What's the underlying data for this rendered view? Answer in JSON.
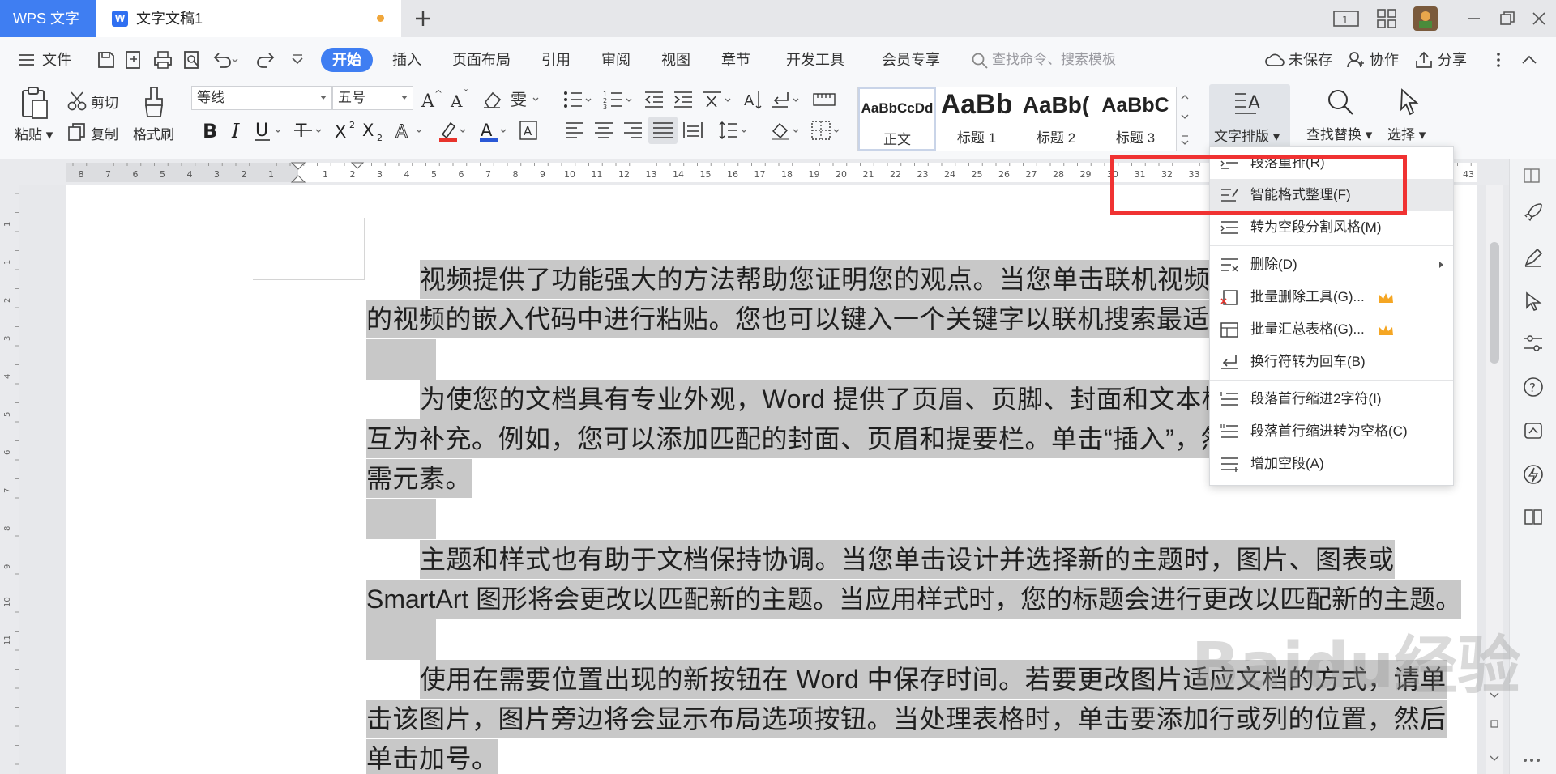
{
  "app": {
    "name": "WPS 文字",
    "document_title": "文字文稿1"
  },
  "menu": {
    "file": "文件",
    "tabs": [
      "开始",
      "插入",
      "页面布局",
      "引用",
      "审阅",
      "视图",
      "章节",
      "开发工具",
      "会员专享"
    ],
    "search_placeholder": "查找命令、搜索模板",
    "unsaved": "未保存",
    "collaborate": "协作",
    "share": "分享"
  },
  "ribbon": {
    "paste": "粘贴",
    "cut": "剪切",
    "copy": "复制",
    "format_painter": "格式刷",
    "font_name": "等线",
    "font_size": "五号",
    "styles": [
      {
        "preview": "AaBbCcDd",
        "name": "正文"
      },
      {
        "preview": "AaBb",
        "name": "标题 1"
      },
      {
        "preview": "AaBb(",
        "name": "标题 2"
      },
      {
        "preview": "AaBbC",
        "name": "标题 3"
      }
    ],
    "text_layout": "文字排版",
    "find_replace": "查找替换",
    "select": "选择"
  },
  "ruler": {
    "left_numbers": [
      "8",
      "7",
      "6",
      "5",
      "4",
      "3",
      "2",
      "1"
    ],
    "right_numbers": [
      "1",
      "2",
      "3",
      "4",
      "5",
      "6",
      "7",
      "8",
      "9",
      "10",
      "11",
      "12",
      "13",
      "14",
      "15",
      "16",
      "17",
      "18",
      "19",
      "20",
      "21",
      "22",
      "23",
      "24",
      "25",
      "26",
      "27",
      "28",
      "29",
      "30",
      "31",
      "32",
      "33"
    ],
    "end_number": "43",
    "v_numbers": [
      "1",
      "1",
      "2",
      "3",
      "4",
      "5",
      "6",
      "7",
      "8",
      "9",
      "10",
      "11"
    ]
  },
  "document": {
    "paragraphs": [
      [
        "视频提供了功能强大的方法帮助您证明您的观点。当您单击联机视频时，",
        "的视频的嵌入代码中进行粘贴。您也可以键入一个关键字以联机搜索最适合您"
      ],
      [
        "为使您的文档具有专业外观，Word 提供了页眉、页脚、封面和文本框设",
        "互为补充。例如，您可以添加匹配的封面、页眉和提要栏。单击“插入”，然后从",
        "需元素。"
      ],
      [
        "主题和样式也有助于文档保持协调。当您单击设计并选择新的主题时，图片、图表或",
        "SmartArt 图形将会更改以匹配新的主题。当应用样式时，您的标题会进行更改以匹配新的主题。"
      ],
      [
        "使用在需要位置出现的新按钮在 Word 中保存时间。若要更改图片适应文档的方式，请单",
        "击该图片，图片旁边将会显示布局选项按钮。当处理表格时，单击要添加行或列的位置，然后",
        "单击加号。"
      ]
    ]
  },
  "dropdown": {
    "items": [
      {
        "label": "段落重排(R)",
        "icon": "paragraph-rearrange-icon"
      },
      {
        "label": "智能格式整理(F)",
        "icon": "smart-format-icon",
        "highlighted": true
      },
      {
        "label": "转为空段分割风格(M)",
        "icon": "empty-paragraph-split-icon"
      },
      {
        "label": "删除(D)",
        "icon": "delete-icon",
        "submenu": true
      },
      {
        "label": "批量删除工具(G)...",
        "icon": "batch-delete-icon",
        "vip": true
      },
      {
        "label": "批量汇总表格(G)...",
        "icon": "batch-summary-icon",
        "vip": true
      },
      {
        "label": "换行符转为回车(B)",
        "icon": "line-break-icon"
      },
      {
        "label": "段落首行缩进2字符(I)",
        "icon": "first-line-indent-icon"
      },
      {
        "label": "段落首行缩进转为空格(C)",
        "icon": "indent-to-space-icon"
      },
      {
        "label": "增加空段(A)",
        "icon": "add-empty-paragraph-icon"
      }
    ]
  },
  "watermark": "Baidu经验",
  "colors": {
    "accent": "#3f7ef2",
    "highlight_box": "#f03232",
    "selection": "#c8c8c8",
    "vip_crown": "#f5a623"
  }
}
